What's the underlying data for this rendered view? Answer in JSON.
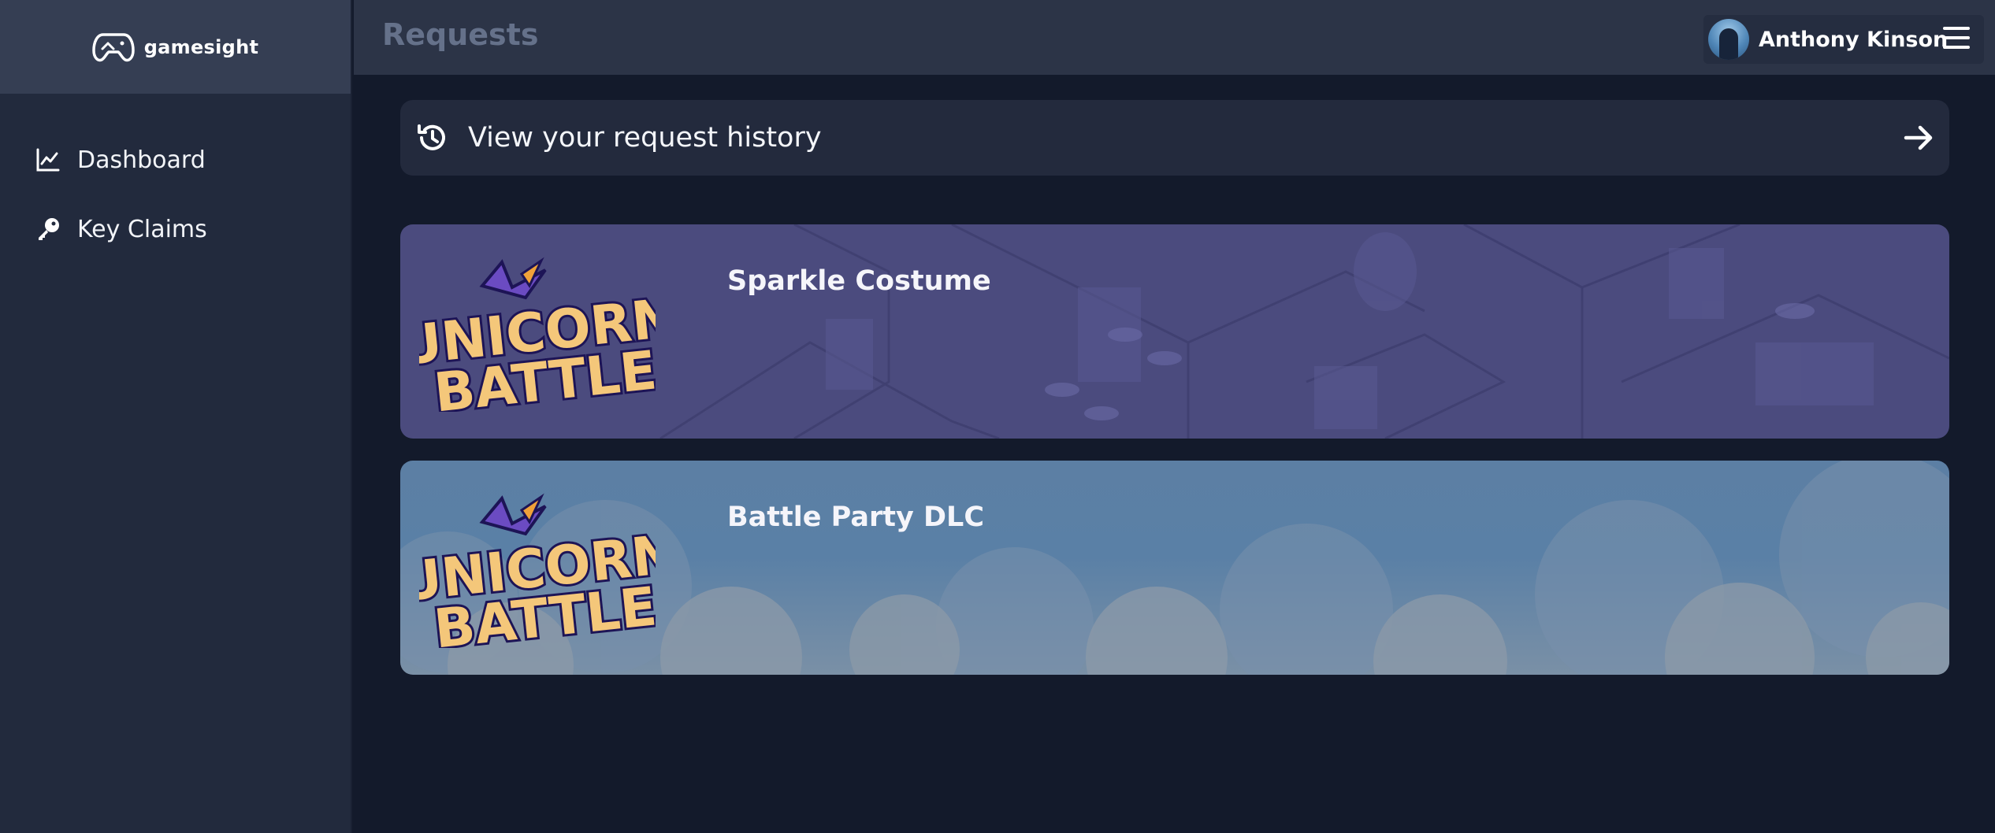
{
  "brand": {
    "name": "gamesight",
    "icon": "gamepad-icon"
  },
  "sidebar": {
    "items": [
      {
        "label": "Dashboard",
        "icon": "chart-line-icon"
      },
      {
        "label": "Key Claims",
        "icon": "key-icon"
      }
    ]
  },
  "header": {
    "title": "Requests",
    "user_name": "Anthony Kinson",
    "menu_icon": "hamburger-menu-icon"
  },
  "history": {
    "label": "View your request history",
    "icon": "history-icon",
    "action_icon": "arrow-right-icon"
  },
  "cards": [
    {
      "title": "Sparkle Costume",
      "logo_line1": "UNICORN",
      "logo_line2": "BATTLE",
      "theme_color": "#4b4b7e"
    },
    {
      "title": "Battle Party DLC",
      "logo_line1": "UNICORN",
      "logo_line2": "BATTLE",
      "theme_color": "#5a80a6"
    }
  ],
  "colors": {
    "background": "#131a2b",
    "sidebar": "#222a3d",
    "header": "#2c3447",
    "title_muted": "#65718a"
  }
}
